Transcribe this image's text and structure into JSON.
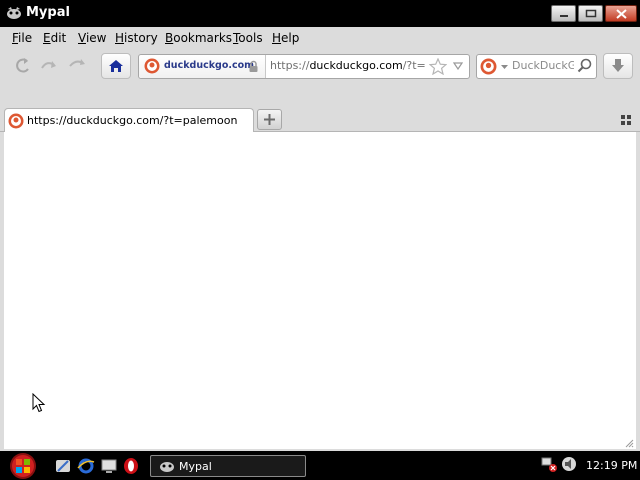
{
  "window": {
    "title": "Mypal",
    "controls": [
      "minimize-icon",
      "maximize-icon",
      "close-icon"
    ]
  },
  "menubar": {
    "items": [
      {
        "label": "File",
        "underline": "F"
      },
      {
        "label": "Edit",
        "underline": "E"
      },
      {
        "label": "View",
        "underline": "V"
      },
      {
        "label": "History",
        "underline": "H"
      },
      {
        "label": "Bookmarks",
        "underline": "B"
      },
      {
        "label": "Tools",
        "underline": "T"
      },
      {
        "label": "Help",
        "underline": "H"
      }
    ]
  },
  "toolbar": {
    "identity_label": "duckduckgo.com",
    "url_prefix": "https://",
    "url_host": "duckduckgo.com",
    "url_rest": "/?t=paler",
    "search_placeholder": "DuckDuckGo"
  },
  "tabs": [
    {
      "label": "https://duckduckgo.com/?t=palemoon",
      "active": true
    }
  ],
  "taskbar": {
    "task_label": "Mypal",
    "clock": "12:19 PM"
  },
  "colors": {
    "accent": "#de5833",
    "identity_text": "#2a3a8a",
    "home_icon": "#1a2f9c"
  }
}
